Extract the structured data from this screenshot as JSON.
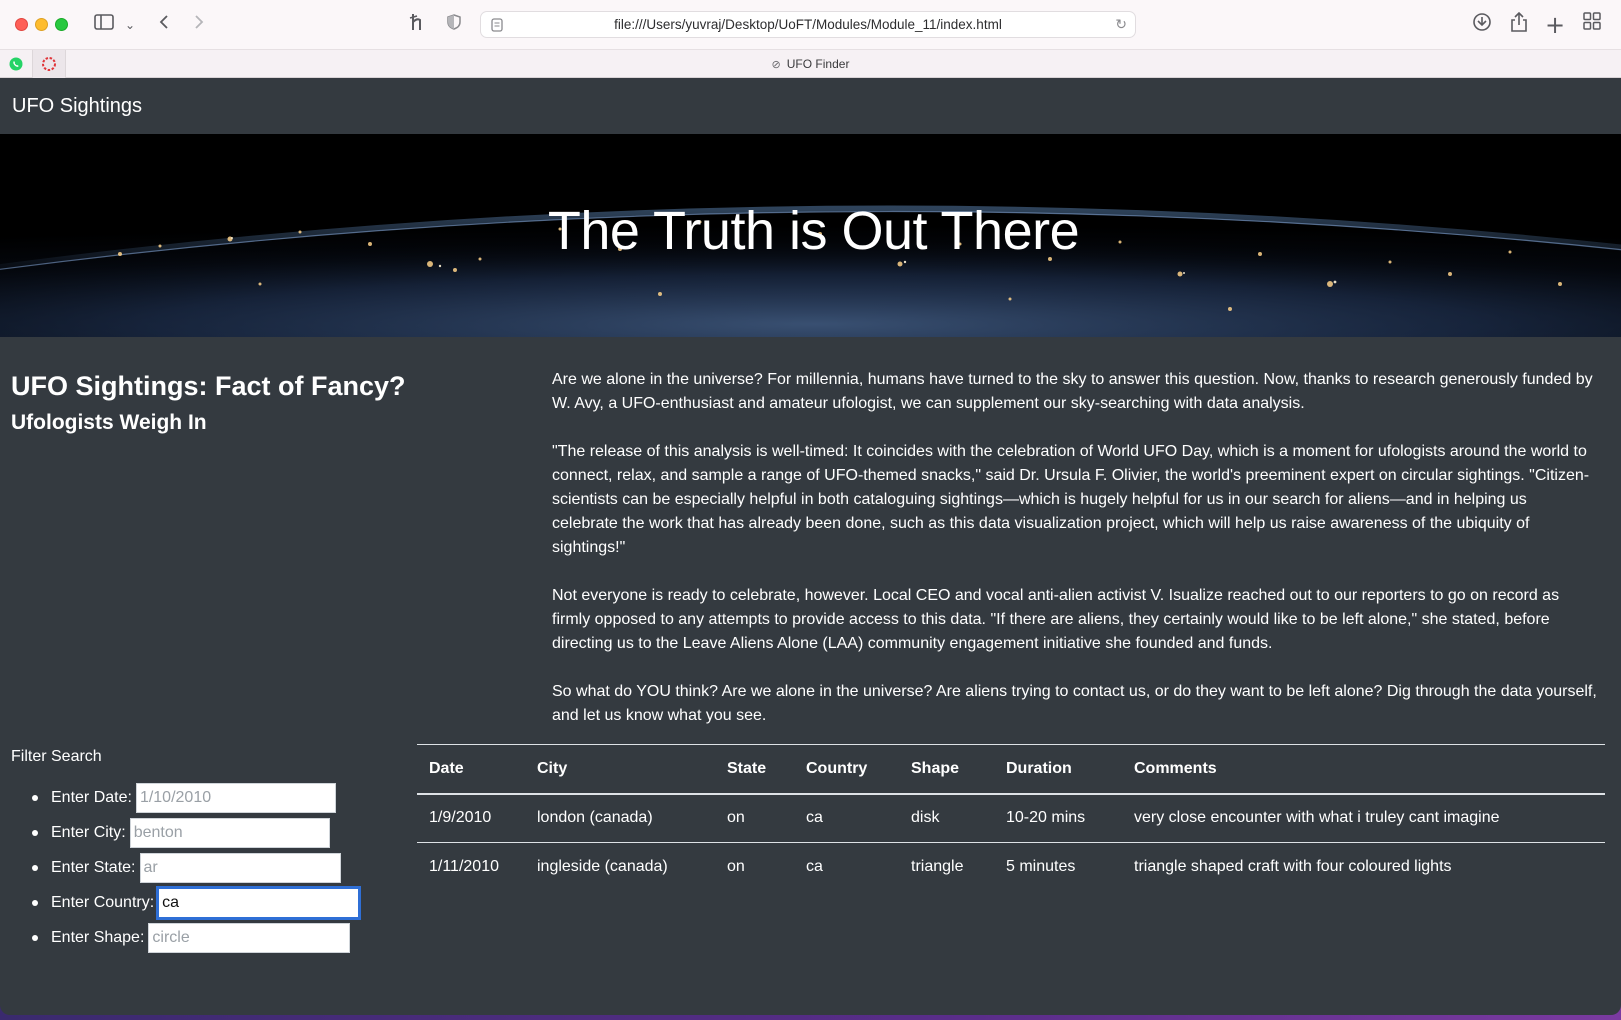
{
  "browser": {
    "url": "file:///Users/yuvraj/Desktop/UoFT/Modules/Module_11/index.html",
    "tab_title": "UFO Finder"
  },
  "navbar": {
    "brand": "UFO Sightings"
  },
  "hero": {
    "title": "The Truth is Out There"
  },
  "article": {
    "heading_main": "UFO Sightings: Fact of Fancy?",
    "heading_sub": "Ufologists Weigh In",
    "paragraphs": [
      "Are we alone in the universe? For millennia, humans have turned to the sky to answer this question. Now, thanks to research generously funded by W. Avy, a UFO-enthusiast and amateur ufologist, we can supplement our sky-searching with data analysis.",
      "\"The release of this analysis is well-timed: It coincides with the celebration of World UFO Day, which is a moment for ufologists around the world to connect, relax, and sample a range of UFO-themed snacks,\" said Dr. Ursula F. Olivier, the world's preeminent expert on circular sightings. \"Citizen-scientists can be especially helpful in both cataloguing sightings—which is hugely helpful for us in our search for aliens—and in helping us celebrate the work that has already been done, such as this data visualization project, which will help us raise awareness of the ubiquity of sightings!\"",
      "Not everyone is ready to celebrate, however. Local CEO and vocal anti-alien activist V. Isualize reached out to our reporters to go on record as firmly opposed to any attempts to provide access to this data. \"If there are aliens, they certainly would like to be left alone,\" she stated, before directing us to the Leave Aliens Alone (LAA) community engagement initiative she founded and funds.",
      "So what do YOU think? Are we alone in the universe? Are aliens trying to contact us, or do they want to be left alone? Dig through the data yourself, and let us know what you see."
    ]
  },
  "filters": {
    "heading": "Filter Search",
    "date": {
      "label": "Enter Date:",
      "placeholder": "1/10/2010",
      "value": ""
    },
    "city": {
      "label": "Enter City:",
      "placeholder": "benton",
      "value": ""
    },
    "state": {
      "label": "Enter State:",
      "placeholder": "ar",
      "value": ""
    },
    "country": {
      "label": "Enter Country:",
      "placeholder": "",
      "value": "ca"
    },
    "shape": {
      "label": "Enter Shape:",
      "placeholder": "circle",
      "value": ""
    }
  },
  "table": {
    "headers": [
      "Date",
      "City",
      "State",
      "Country",
      "Shape",
      "Duration",
      "Comments"
    ],
    "rows": [
      [
        "1/9/2010",
        "london (canada)",
        "on",
        "ca",
        "disk",
        "10-20 mins",
        "very close encounter with what i truley cant imagine"
      ],
      [
        "1/11/2010",
        "ingleside (canada)",
        "on",
        "ca",
        "triangle",
        "5 minutes",
        "triangle shaped craft with four coloured lights"
      ]
    ]
  }
}
